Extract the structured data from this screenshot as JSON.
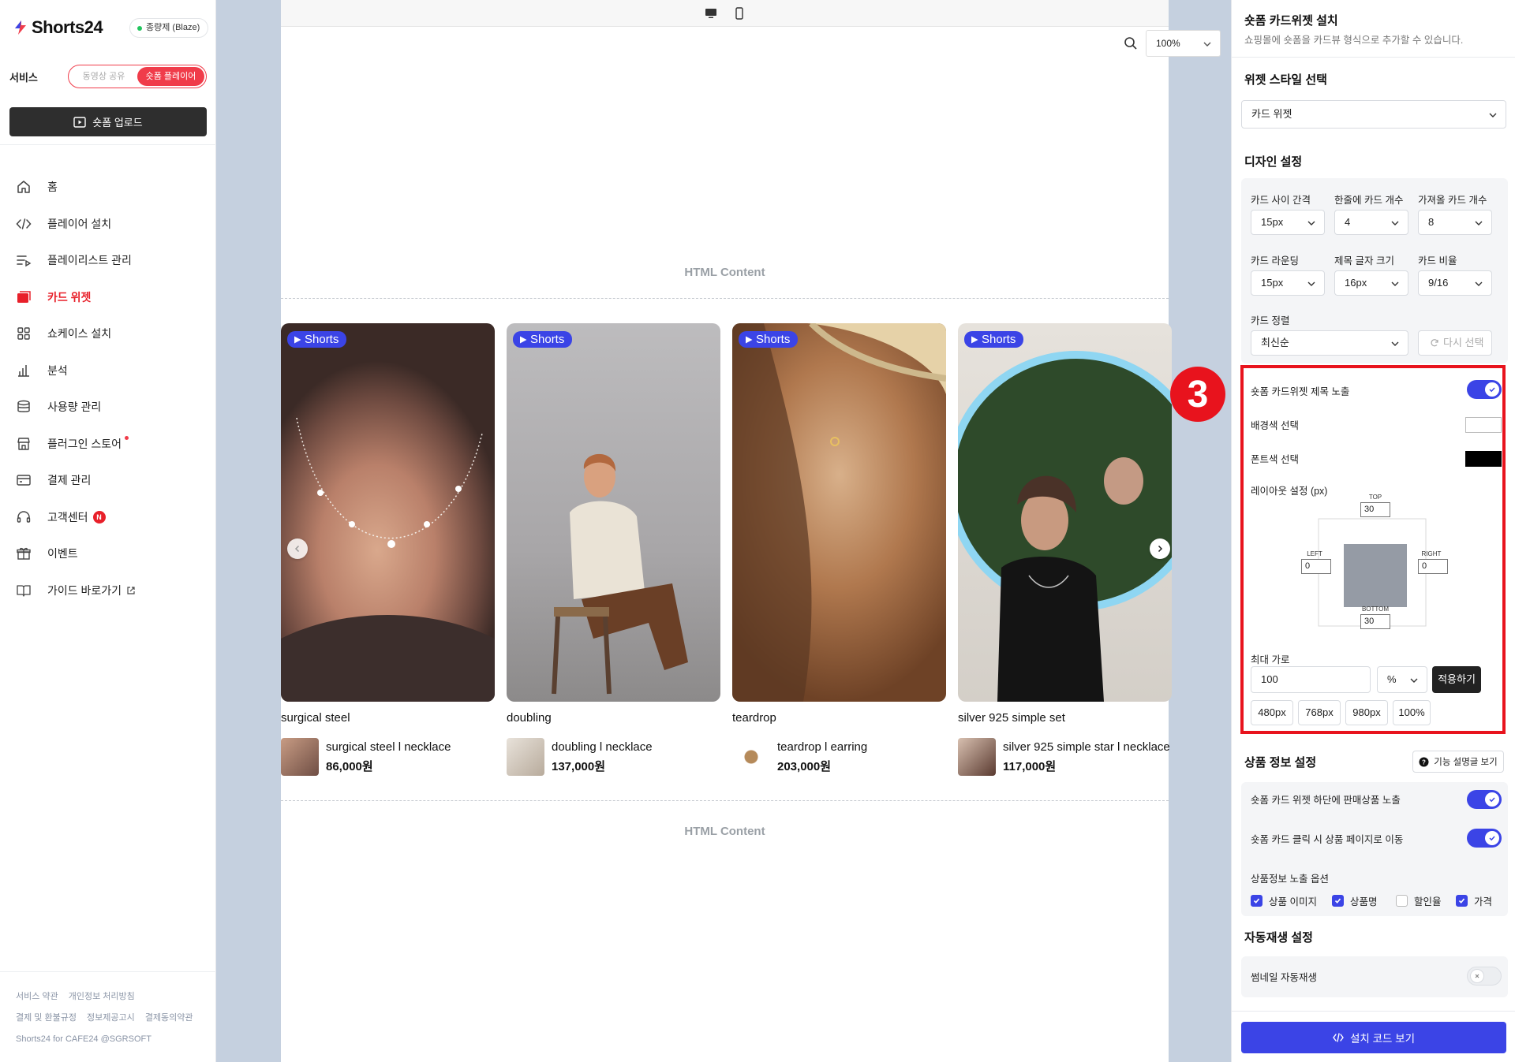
{
  "brand": {
    "name": "Shorts24",
    "plan": "종량제 (Blaze)"
  },
  "service": {
    "label": "서비스",
    "options": [
      "동영상 공유",
      "숏폼 플레이어"
    ],
    "active": 1
  },
  "upload_button": "숏폼 업로드",
  "nav": [
    {
      "label": "홈",
      "icon": "home-icon"
    },
    {
      "label": "플레이어 설치",
      "icon": "code-icon"
    },
    {
      "label": "플레이리스트 관리",
      "icon": "playlist-icon"
    },
    {
      "label": "카드 위젯",
      "icon": "card-widget-icon",
      "active": true
    },
    {
      "label": "쇼케이스 설치",
      "icon": "grid-icon"
    },
    {
      "label": "분석",
      "icon": "bar-chart-icon"
    },
    {
      "label": "사용량 관리",
      "icon": "database-icon"
    },
    {
      "label": "플러그인 스토어",
      "icon": "store-icon"
    },
    {
      "label": "결제 관리",
      "icon": "payment-icon"
    },
    {
      "label": "고객센터",
      "icon": "headset-icon",
      "badge": "N"
    },
    {
      "label": "이벤트",
      "icon": "gift-icon"
    },
    {
      "label": "가이드 바로가기",
      "icon": "book-icon"
    }
  ],
  "footer": {
    "links_row1": [
      "서비스 약관",
      "개인정보 처리방침"
    ],
    "links_row2": [
      "결제 및 환불규정",
      "정보제공고시",
      "결제동의약관"
    ],
    "copyright": "Shorts24 for CAFE24 @SGRSOFT"
  },
  "preview": {
    "zoom": "100%",
    "html_content_label": "HTML Content",
    "tag_label": "Shorts",
    "cards": [
      {
        "title": "surgical steel",
        "product": "surgical steel l necklace",
        "price": "86,000원"
      },
      {
        "title": "doubling",
        "product": "doubling l necklace",
        "price": "137,000원"
      },
      {
        "title": "teardrop",
        "product": "teardrop l earring",
        "price": "203,000원"
      },
      {
        "title": "silver 925 simple set",
        "product": "silver 925 simple star l necklace",
        "price": "117,000원"
      }
    ],
    "step_number": "3"
  },
  "panel": {
    "title": "숏폼 카드위젯 설치",
    "subtitle": "쇼핑몰에 숏폼을 카드뷰 형식으로 추가할 수 있습니다.",
    "widget_style": {
      "title": "위젯 스타일 선택",
      "value": "카드 위젯"
    },
    "design": {
      "title": "디자인 설정",
      "card_gap": {
        "label": "카드 사이 간격",
        "value": "15px"
      },
      "per_row": {
        "label": "한줄에 카드 개수",
        "value": "4"
      },
      "fetch_count": {
        "label": "가져올 카드 개수",
        "value": "8"
      },
      "rounding": {
        "label": "카드 라운딩",
        "value": "15px"
      },
      "title_size": {
        "label": "제목 글자 크기",
        "value": "16px"
      },
      "ratio": {
        "label": "카드 비율",
        "value": "9/16"
      },
      "sort": {
        "label": "카드 정렬",
        "value": "최신순"
      },
      "reselect": "다시 선택"
    },
    "layout": {
      "title_toggle": "숏폼 카드위젯 제목 노출",
      "title_toggle_on": true,
      "bg_color_label": "배경색 선택",
      "bg_color": "#ffffff",
      "font_color_label": "폰트색 선택",
      "font_color": "#000000",
      "layout_label": "레이아웃 설정 (px)",
      "top_label": "TOP",
      "top": "30",
      "left_label": "LEFT",
      "left": "0",
      "right_label": "RIGHT",
      "right": "0",
      "bottom_label": "BOTTOM",
      "bottom": "30",
      "max_width_label": "최대 가로",
      "max_width": "100",
      "unit": "%",
      "apply": "적용하기",
      "presets": [
        "480px",
        "768px",
        "980px",
        "100%"
      ]
    },
    "product_info": {
      "title": "상품 정보 설정",
      "help": "기능 설명글 보기",
      "show_products": "숏폼 카드 위젯 하단에 판매상품 노출",
      "show_products_on": true,
      "goto_product": "숏폼 카드 클릭 시 상품 페이지로 이동",
      "goto_product_on": true,
      "options_label": "상품정보 노출 옵션",
      "options": [
        {
          "label": "상품 이미지",
          "checked": true
        },
        {
          "label": "상품명",
          "checked": true
        },
        {
          "label": "할인율",
          "checked": false
        },
        {
          "label": "가격",
          "checked": true
        }
      ]
    },
    "autoplay": {
      "title": "자동재생 설정",
      "thumbnail": "썸네일 자동재생",
      "thumbnail_on": false
    },
    "code_button": "설치 코드 보기"
  },
  "colors": {
    "accent": "#3b44e6",
    "brand_red": "#e8202a",
    "dark": "#222222"
  }
}
